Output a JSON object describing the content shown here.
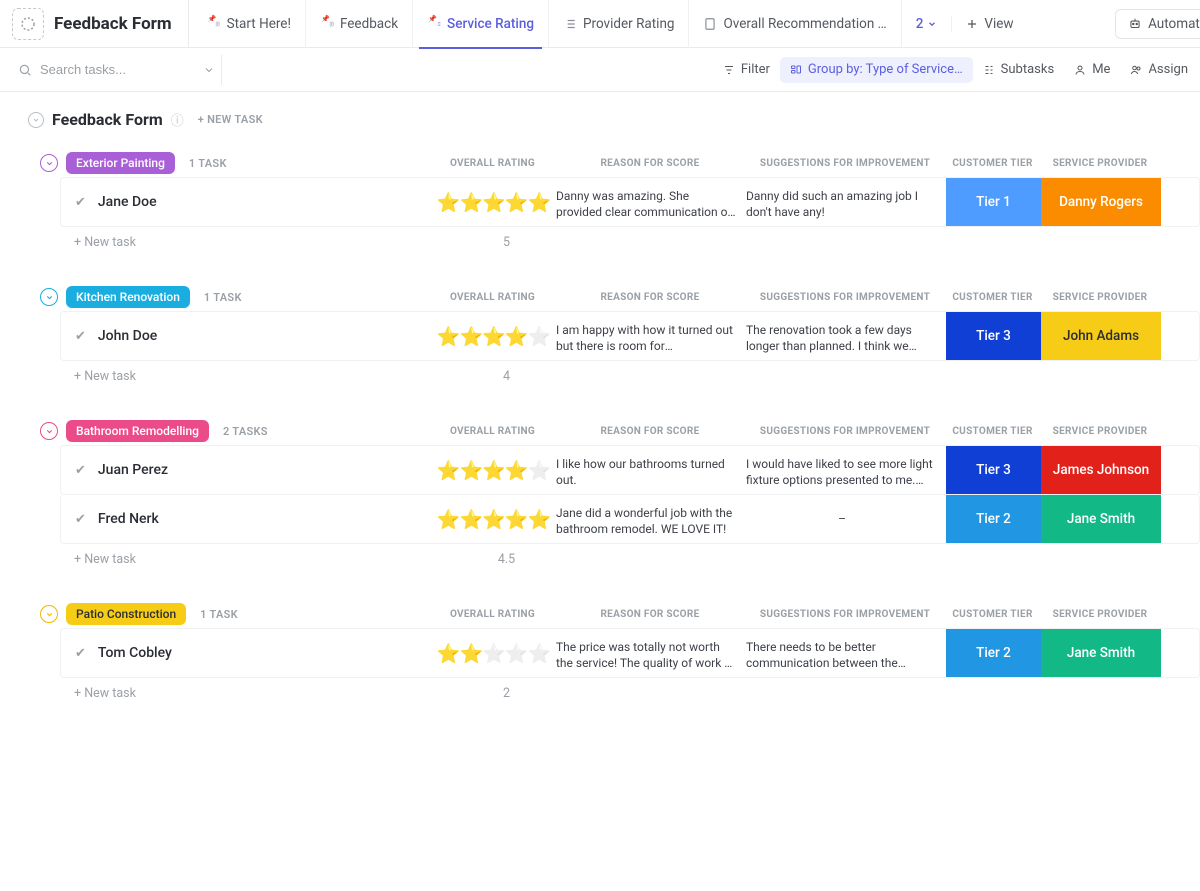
{
  "app_title": "Feedback Form",
  "tabs": [
    {
      "label": "Start Here!"
    },
    {
      "label": "Feedback"
    },
    {
      "label": "Service Rating",
      "active": true
    },
    {
      "label": "Provider Rating"
    },
    {
      "label": "Overall Recommendation …"
    }
  ],
  "more_count": "2",
  "view_label": "View",
  "automate_label": "Automate",
  "toolbar": {
    "search_placeholder": "Search tasks...",
    "filter": "Filter",
    "group_by": "Group by: Type of Service…",
    "subtasks": "Subtasks",
    "me": "Me",
    "assign": "Assign"
  },
  "section_title": "Feedback Form",
  "section_new_task": "+ NEW TASK",
  "col_headers": {
    "rating": "OVERALL RATING",
    "reason": "REASON FOR SCORE",
    "suggestions": "SUGGESTIONS FOR IMPROVEMENT",
    "tier": "CUSTOMER TIER",
    "provider": "SERVICE PROVIDER"
  },
  "new_task_label": "+ New task",
  "groups": [
    {
      "name": "Exterior Painting",
      "chip": "c-purple",
      "border": "b-purple",
      "count": "1 TASK",
      "avg": "5",
      "rows": [
        {
          "name": "Jane Doe",
          "stars": 5,
          "reason": "Danny was amazing. She provided clear communication of time…",
          "suggestions": "Danny did such an amazing job I don't have any!",
          "tier": "Tier 1",
          "tier_cls": "t-lightblue",
          "provider": "Danny Rogers",
          "prov_cls": "t-orange"
        }
      ]
    },
    {
      "name": "Kitchen Renovation",
      "chip": "c-blue",
      "border": "b-blue",
      "count": "1 TASK",
      "avg": "4",
      "rows": [
        {
          "name": "John Doe",
          "stars": 4,
          "reason": "I am happy with how it turned out but there is room for improvement",
          "suggestions": "The renovation took a few days longer than planned. I think we could have finished on …",
          "tier": "Tier 3",
          "tier_cls": "t-blue",
          "provider": "John Adams",
          "prov_cls": "t-yellow"
        }
      ]
    },
    {
      "name": "Bathroom Remodelling",
      "chip": "c-pink",
      "border": "b-pink",
      "count": "2 TASKS",
      "avg": "4.5",
      "rows": [
        {
          "name": "Juan Perez",
          "stars": 4,
          "reason": "I like how our bathrooms turned out.",
          "suggestions": "I would have liked to see more light fixture options presented to me. The options provided…",
          "tier": "Tier 3",
          "tier_cls": "t-blue",
          "provider": "James Johnson",
          "prov_cls": "t-red"
        },
        {
          "name": "Fred Nerk",
          "stars": 5,
          "reason": "Jane did a wonderful job with the bathroom remodel. WE LOVE IT!",
          "suggestions": "–",
          "sugg_center": true,
          "tier": "Tier 2",
          "tier_cls": "t-skyblue",
          "provider": "Jane Smith",
          "prov_cls": "t-teal"
        }
      ]
    },
    {
      "name": "Patio Construction",
      "chip": "c-yellow",
      "border": "b-yellow",
      "count": "1 TASK",
      "avg": "2",
      "rows": [
        {
          "name": "Tom Cobley",
          "stars": 2,
          "reason": "The price was totally not worth the service! The quality of work …",
          "suggestions": "There needs to be better communication between the designer and the people doing the…",
          "tier": "Tier 2",
          "tier_cls": "t-skyblue",
          "provider": "Jane Smith",
          "prov_cls": "t-teal"
        }
      ]
    }
  ]
}
